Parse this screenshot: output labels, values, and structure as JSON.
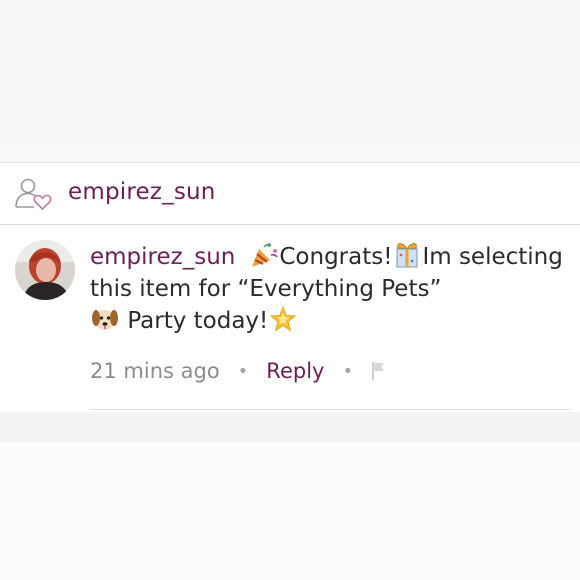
{
  "likes": {
    "icon": "user-heart-icon",
    "username": "empirez_sun"
  },
  "comment": {
    "avatar": "user-avatar",
    "author": "empirez_sun",
    "text_part1": "Congrats!",
    "text_part2": "Im selecting this item for “Everything Pets”",
    "text_part3": "Party today!",
    "emojis": [
      "party-popper-icon",
      "gift-icon",
      "dog-face-icon",
      "glowing-star-icon"
    ],
    "timestamp": "21 mins ago",
    "separator": "•",
    "reply_label": "Reply",
    "flag_icon": "flag-icon"
  },
  "colors": {
    "accent": "#6b1f55",
    "muted": "#8e8c8a",
    "background": "#ffffff"
  }
}
